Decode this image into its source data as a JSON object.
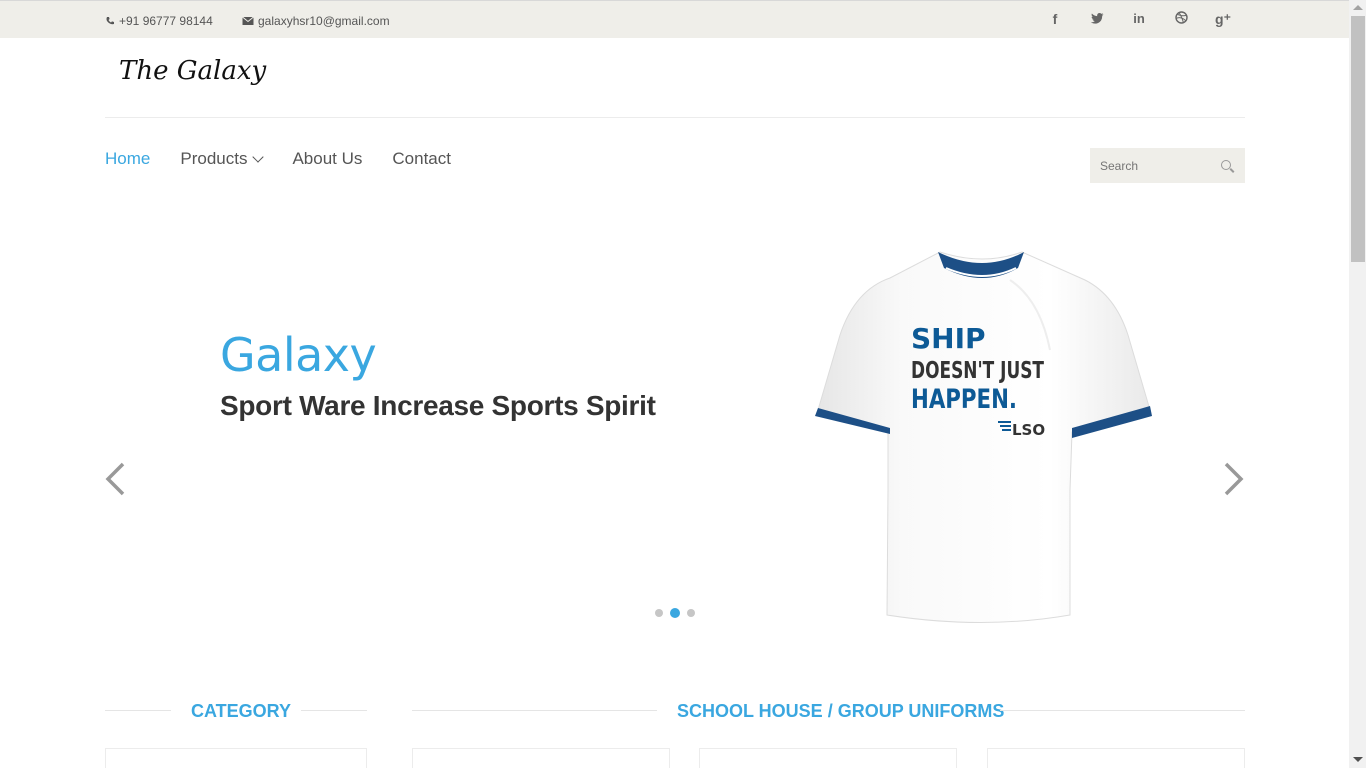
{
  "topbar": {
    "phone": "+91 96777 98144",
    "email": "galaxyhsr10@gmail.com",
    "socials": [
      {
        "name": "facebook-icon",
        "glyph": "f"
      },
      {
        "name": "twitter-icon",
        "glyph": "🐦"
      },
      {
        "name": "linkedin-icon",
        "glyph": "in"
      },
      {
        "name": "dribbble-icon",
        "glyph": "⊛"
      },
      {
        "name": "google-plus-icon",
        "glyph": "g⁺"
      }
    ]
  },
  "logo": {
    "text": "The Galaxy"
  },
  "nav": {
    "items": [
      {
        "label": "Home",
        "active": true
      },
      {
        "label": "Products",
        "dropdown": true
      },
      {
        "label": "About Us"
      },
      {
        "label": "Contact"
      }
    ]
  },
  "search": {
    "placeholder": "Search"
  },
  "hero": {
    "title": "Galaxy",
    "subtitle": "Sport Ware Increase Sports Spirit",
    "shirt_text": [
      "SHIP",
      "DOESN'T JUST",
      "HAPPEN.",
      "LSO"
    ],
    "active_slide": 2,
    "slide_count": 3
  },
  "sections": {
    "category": "CATEGORY",
    "uniforms": "SCHOOL HOUSE / GROUP UNIFORMS"
  },
  "colors": {
    "accent": "#3aa7e0",
    "topbar_bg": "#efeee9",
    "text": "#333333",
    "shirt_trim": "#1d4f86",
    "shirt_print_blue": "#0d5a96"
  }
}
